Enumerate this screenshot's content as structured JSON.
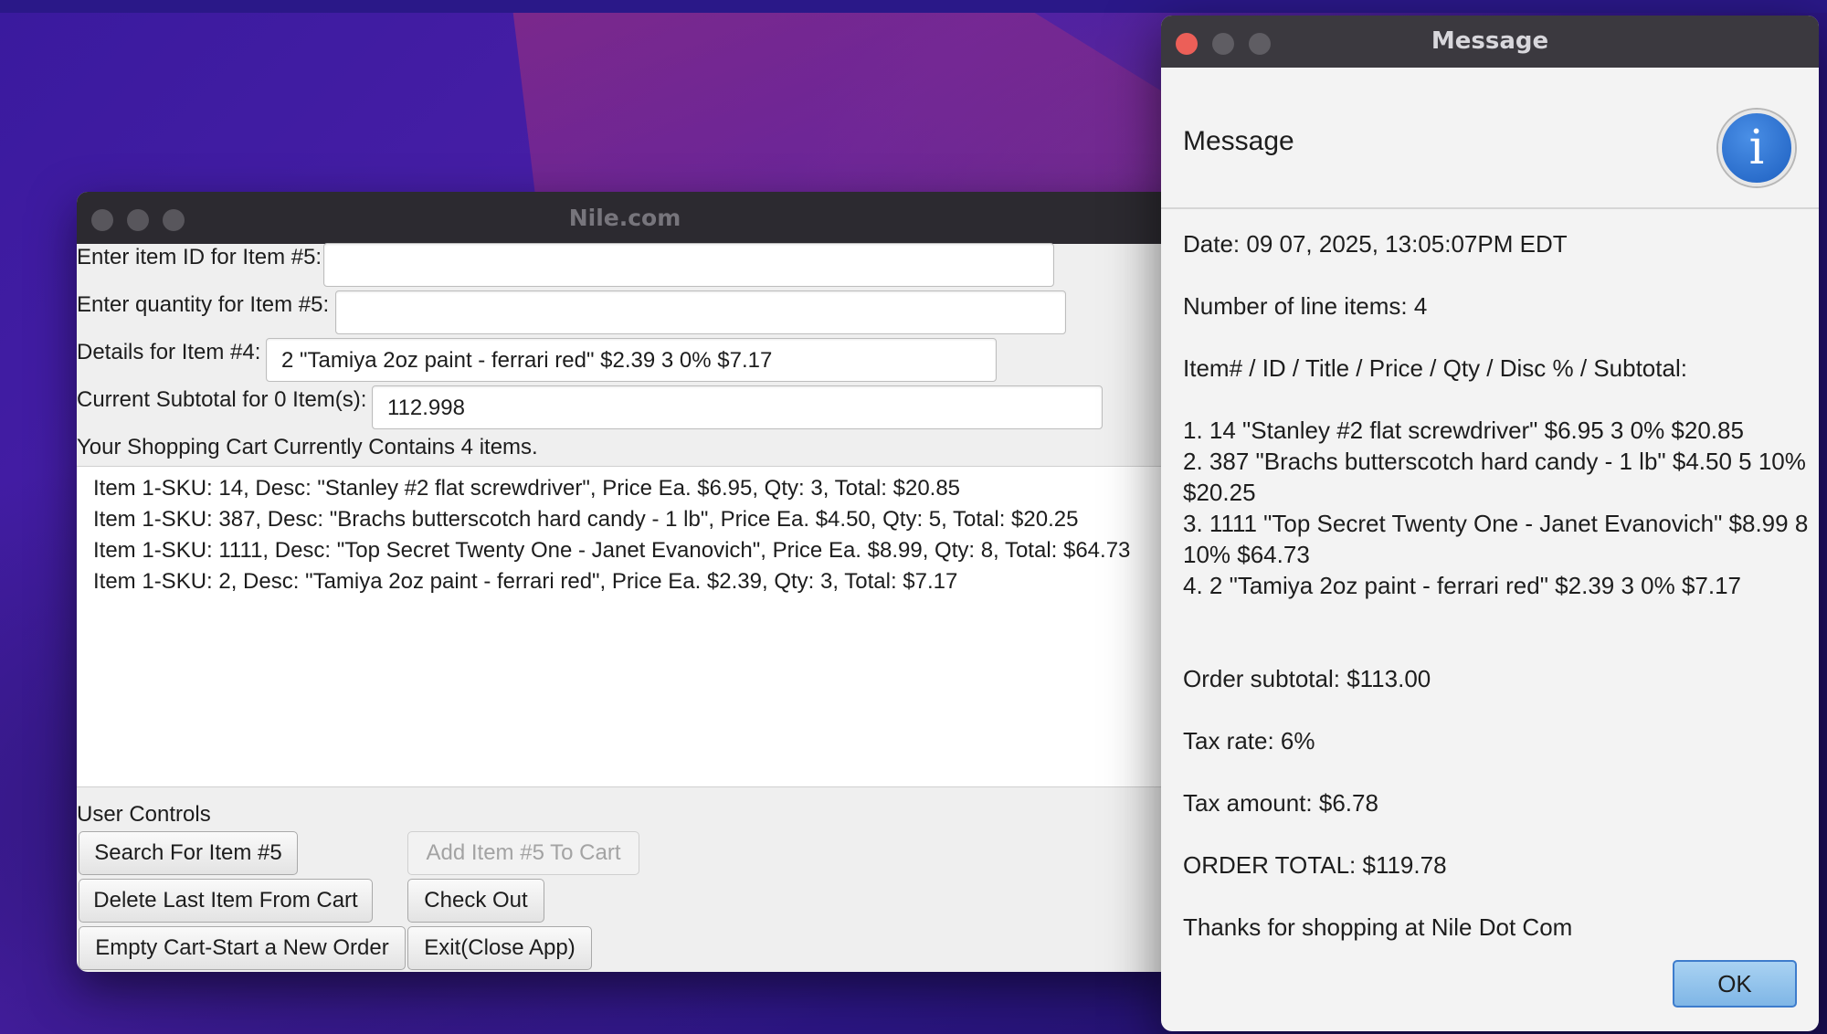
{
  "main_window": {
    "title": "Nile.com",
    "item_id_label": "Enter item ID for Item #5:",
    "item_id_value": "",
    "quantity_label": "Enter quantity for Item #5:",
    "quantity_value": "",
    "details_label": "Details for Item #4:",
    "details_value": "2 \"Tamiya 2oz paint - ferrari red\" $2.39 3 0% $7.17",
    "subtotal_label": "Current Subtotal for 0 Item(s):",
    "subtotal_value": "112.998",
    "cart_header": "Your Shopping Cart Currently Contains 4 items.",
    "cart_items": [
      "Item 1-SKU: 14, Desc: \"Stanley #2 flat screwdriver\", Price Ea. $6.95, Qty: 3, Total: $20.85",
      "Item 1-SKU: 387, Desc: \"Brachs butterscotch hard candy - 1 lb\", Price Ea. $4.50, Qty: 5, Total: $20.25",
      "Item 1-SKU: 1111, Desc: \"Top Secret Twenty One - Janet Evanovich\", Price Ea. $8.99, Qty: 8, Total: $64.73",
      "Item 1-SKU: 2, Desc: \"Tamiya 2oz paint - ferrari red\", Price Ea. $2.39, Qty: 3, Total: $7.17"
    ],
    "controls_label": "User Controls",
    "buttons": {
      "search": "Search For Item #5",
      "add": "Add Item #5 To Cart",
      "delete": "Delete Last Item From Cart",
      "checkout": "Check Out",
      "empty": "Empty Cart-Start a New Order",
      "exit": "Exit(Close App)"
    }
  },
  "message_dialog": {
    "title": "Message",
    "header": "Message",
    "icon": "info-icon",
    "icon_glyph": "i",
    "lines": {
      "date": "Date: 09 07, 2025, 13:05:07PM EDT",
      "line_count": "Number of line items: 4",
      "columns": "Item# / ID / Title / Price / Qty / Disc % / Subtotal:",
      "item1": "1. 14 \"Stanley #2 flat screwdriver\" $6.95 3 0% $20.85",
      "item2a": "2. 387 \"Brachs butterscotch hard candy - 1 lb\" $4.50 5 10%",
      "item2b": "$20.25",
      "item3a": "3. 1111 \"Top Secret Twenty One - Janet Evanovich\" $8.99 8",
      "item3b": "10% $64.73",
      "item4": "4. 2 \"Tamiya 2oz paint - ferrari red\" $2.39 3 0% $7.17",
      "order_subtotal": "Order subtotal: $113.00",
      "tax_rate": "Tax rate: 6%",
      "tax_amount": "Tax amount: $6.78",
      "order_total": "ORDER TOTAL: $119.78",
      "thanks": "Thanks for shopping at Nile Dot Com"
    },
    "ok_label": "OK"
  }
}
